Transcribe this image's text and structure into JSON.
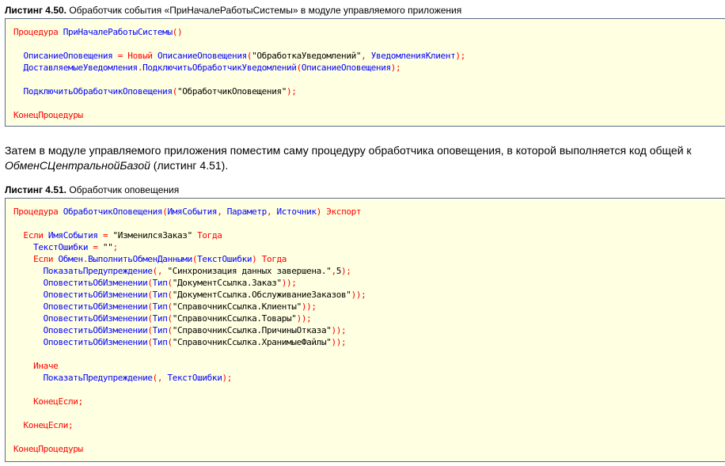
{
  "listing1": {
    "caption_bold": "Листинг 4.50.",
    "caption_text": " Обработчик события «ПриНачалеРаботыСистемы» в модуле управляемого приложения",
    "code": [
      [
        [
          "kw",
          "Процедура"
        ],
        [
          "s",
          " "
        ],
        [
          "id",
          "ПриНачалеРаботыСистемы"
        ],
        [
          "op",
          "()"
        ]
      ],
      [],
      [
        [
          "s",
          "  "
        ],
        [
          "id",
          "ОписаниеОповещения"
        ],
        [
          "s",
          " "
        ],
        [
          "op",
          "="
        ],
        [
          "s",
          " "
        ],
        [
          "kw",
          "Новый"
        ],
        [
          "s",
          " "
        ],
        [
          "id",
          "ОписаниеОповещения"
        ],
        [
          "op",
          "("
        ],
        [
          "s",
          "\"ОбработкаУведомлений\""
        ],
        [
          "op",
          ","
        ],
        [
          "s",
          " "
        ],
        [
          "id",
          "УведомленияКлиент"
        ],
        [
          "op",
          ");"
        ]
      ],
      [
        [
          "s",
          "  "
        ],
        [
          "id",
          "ДоставляемыеУведомления"
        ],
        [
          "op",
          "."
        ],
        [
          "id",
          "ПодключитьОбработчикУведомлений"
        ],
        [
          "op",
          "("
        ],
        [
          "id",
          "ОписаниеОповещения"
        ],
        [
          "op",
          ");"
        ]
      ],
      [],
      [
        [
          "s",
          "  "
        ],
        [
          "id",
          "ПодключитьОбработчикОповещения"
        ],
        [
          "op",
          "("
        ],
        [
          "s",
          "\"ОбработчикОповещения\""
        ],
        [
          "op",
          ");"
        ]
      ],
      [],
      [
        [
          "kw",
          "КонецПроцедуры"
        ]
      ]
    ]
  },
  "paragraph": {
    "text1": "Затем в модуле управляемого приложения поместим саму процедуру обработчика оповещения, в которой выполняется код общей к",
    "italic": "ОбменСЦентральнойБазой",
    "text2": " (листинг 4.51)."
  },
  "listing2": {
    "caption_bold": "Листинг 4.51.",
    "caption_text": " Обработчик оповещения",
    "code": [
      [
        [
          "kw",
          "Процедура"
        ],
        [
          "s",
          " "
        ],
        [
          "id",
          "ОбработчикОповещения"
        ],
        [
          "op",
          "("
        ],
        [
          "id",
          "ИмяСобытия"
        ],
        [
          "op",
          ","
        ],
        [
          "s",
          " "
        ],
        [
          "id",
          "Параметр"
        ],
        [
          "op",
          ","
        ],
        [
          "s",
          " "
        ],
        [
          "id",
          "Источник"
        ],
        [
          "op",
          ")"
        ],
        [
          "s",
          " "
        ],
        [
          "kw",
          "Экспорт"
        ]
      ],
      [],
      [
        [
          "s",
          "  "
        ],
        [
          "kw",
          "Если"
        ],
        [
          "s",
          " "
        ],
        [
          "id",
          "ИмяСобытия"
        ],
        [
          "s",
          " "
        ],
        [
          "op",
          "="
        ],
        [
          "s",
          " \"ИзменилсяЗаказ\" "
        ],
        [
          "kw",
          "Тогда"
        ]
      ],
      [
        [
          "s",
          "    "
        ],
        [
          "id",
          "ТекстОшибки"
        ],
        [
          "s",
          " "
        ],
        [
          "op",
          "="
        ],
        [
          "s",
          " \"\""
        ],
        [
          "op",
          ";"
        ]
      ],
      [
        [
          "s",
          "    "
        ],
        [
          "kw",
          "Если"
        ],
        [
          "s",
          " "
        ],
        [
          "id",
          "Обмен"
        ],
        [
          "op",
          "."
        ],
        [
          "id",
          "ВыполнитьОбменДанными"
        ],
        [
          "op",
          "("
        ],
        [
          "id",
          "ТекстОшибки"
        ],
        [
          "op",
          ")"
        ],
        [
          "s",
          " "
        ],
        [
          "kw",
          "Тогда"
        ]
      ],
      [
        [
          "s",
          "      "
        ],
        [
          "id",
          "ПоказатьПредупреждение"
        ],
        [
          "op",
          "(,"
        ],
        [
          "s",
          " \"Синхронизация данных завершена.\""
        ],
        [
          "op",
          ","
        ],
        [
          "n",
          "5"
        ],
        [
          "op",
          ");"
        ]
      ],
      [
        [
          "s",
          "      "
        ],
        [
          "id",
          "ОповеститьОбИзменении"
        ],
        [
          "op",
          "("
        ],
        [
          "id",
          "Тип"
        ],
        [
          "op",
          "("
        ],
        [
          "s",
          "\"ДокументСсылка.Заказ\""
        ],
        [
          "op",
          "));"
        ]
      ],
      [
        [
          "s",
          "      "
        ],
        [
          "id",
          "ОповеститьОбИзменении"
        ],
        [
          "op",
          "("
        ],
        [
          "id",
          "Тип"
        ],
        [
          "op",
          "("
        ],
        [
          "s",
          "\"ДокументСсылка.ОбслуживаниеЗаказов\""
        ],
        [
          "op",
          "));"
        ]
      ],
      [
        [
          "s",
          "      "
        ],
        [
          "id",
          "ОповеститьОбИзменении"
        ],
        [
          "op",
          "("
        ],
        [
          "id",
          "Тип"
        ],
        [
          "op",
          "("
        ],
        [
          "s",
          "\"СправочникСсылка.Клиенты\""
        ],
        [
          "op",
          "));"
        ]
      ],
      [
        [
          "s",
          "      "
        ],
        [
          "id",
          "ОповеститьОбИзменении"
        ],
        [
          "op",
          "("
        ],
        [
          "id",
          "Тип"
        ],
        [
          "op",
          "("
        ],
        [
          "s",
          "\"СправочникСсылка.Товары\""
        ],
        [
          "op",
          "));"
        ]
      ],
      [
        [
          "s",
          "      "
        ],
        [
          "id",
          "ОповеститьОбИзменении"
        ],
        [
          "op",
          "("
        ],
        [
          "id",
          "Тип"
        ],
        [
          "op",
          "("
        ],
        [
          "s",
          "\"СправочникСсылка.ПричиныОтказа\""
        ],
        [
          "op",
          "));"
        ]
      ],
      [
        [
          "s",
          "      "
        ],
        [
          "id",
          "ОповеститьОбИзменении"
        ],
        [
          "op",
          "("
        ],
        [
          "id",
          "Тип"
        ],
        [
          "op",
          "("
        ],
        [
          "s",
          "\"СправочникСсылка.ХранимыеФайлы\""
        ],
        [
          "op",
          "));"
        ]
      ],
      [],
      [
        [
          "s",
          "    "
        ],
        [
          "kw",
          "Иначе"
        ]
      ],
      [
        [
          "s",
          "      "
        ],
        [
          "id",
          "ПоказатьПредупреждение"
        ],
        [
          "op",
          "(,"
        ],
        [
          "s",
          " "
        ],
        [
          "id",
          "ТекстОшибки"
        ],
        [
          "op",
          ");"
        ]
      ],
      [],
      [
        [
          "s",
          "    "
        ],
        [
          "kw",
          "КонецЕсли"
        ],
        [
          "op",
          ";"
        ]
      ],
      [],
      [
        [
          "s",
          "  "
        ],
        [
          "kw",
          "КонецЕсли"
        ],
        [
          "op",
          ";"
        ]
      ],
      [],
      [
        [
          "kw",
          "КонецПроцедуры"
        ]
      ]
    ]
  }
}
